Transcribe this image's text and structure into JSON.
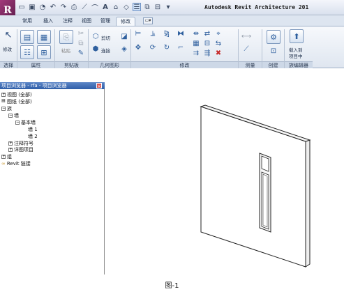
{
  "app": {
    "logo_letter": "R",
    "title": "Autodesk Revit Architecture 201"
  },
  "tabs": [
    {
      "label": "常用",
      "active": false
    },
    {
      "label": "插入",
      "active": false
    },
    {
      "label": "注释",
      "active": false
    },
    {
      "label": "视图",
      "active": false
    },
    {
      "label": "管理",
      "active": false
    },
    {
      "label": "修改",
      "active": true
    }
  ],
  "ribbon": {
    "modify_label": "修改",
    "paste_label": "粘贴",
    "cut_label": "剪切",
    "join_label": "连接",
    "load_into_project_line1": "载入到",
    "load_into_project_line2": "项目中",
    "panels": [
      "选择",
      "属性",
      "剪贴板",
      "几何图形",
      "修改",
      "测量",
      "创建",
      "族编辑器"
    ]
  },
  "browser": {
    "title": "项目浏览器 - rfa - 项目浏览器",
    "close_glyph": "×",
    "nodes": [
      "视图 (全部)",
      "图纸 (全部)",
      "族",
      "墙",
      "基本墙",
      "墙 1",
      "墙 2",
      "注释符号",
      "详图项目",
      "组",
      "Revit 链接"
    ]
  },
  "caption": "图-1"
}
